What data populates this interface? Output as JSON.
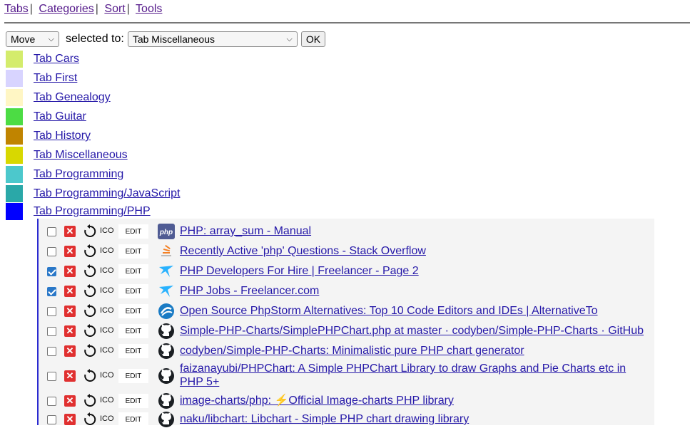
{
  "nav": {
    "tabs": "Tabs",
    "categories": "Categories",
    "sort": "Sort",
    "tools": "Tools"
  },
  "movebar": {
    "action": "Move",
    "selected_to": "selected to:",
    "target": "Tab Miscellaneous",
    "ok": "OK"
  },
  "tabs": [
    {
      "label": "Tab Cars",
      "color": "#d4ec6c"
    },
    {
      "label": "Tab First",
      "color": "#d8d4ff"
    },
    {
      "label": "Tab Genealogy",
      "color": "#fff6c4"
    },
    {
      "label": "Tab Guitar",
      "color": "#4cdc44"
    },
    {
      "label": "Tab History",
      "color": "#c08400"
    },
    {
      "label": "Tab Miscellaneous",
      "color": "#d8d800"
    },
    {
      "label": "Tab Programming",
      "color": "#4cc8cc"
    },
    {
      "label": "Tab Programming/JavaScript",
      "color": "#2aa8a8"
    },
    {
      "label": "Tab Programming/PHP",
      "color": "#0000ff"
    }
  ],
  "links": [
    {
      "checked": false,
      "icon": "php-icon",
      "ico": "ICO",
      "edit": "EDIT",
      "title": "PHP: array_sum - Manual"
    },
    {
      "checked": false,
      "icon": "stackoverflow-icon",
      "ico": "ICO",
      "edit": "EDIT",
      "title": "Recently Active 'php' Questions - Stack Overflow"
    },
    {
      "checked": true,
      "icon": "freelancer-icon",
      "ico": "ICO",
      "edit": "EDIT",
      "title": "PHP Developers For Hire | Freelancer - Page 2"
    },
    {
      "checked": true,
      "icon": "freelancer-icon",
      "ico": "ICO",
      "edit": "EDIT",
      "title": "PHP Jobs - Freelancer.com"
    },
    {
      "checked": false,
      "icon": "alternativeto-icon",
      "ico": "ICO",
      "edit": "EDIT",
      "title": "Open Source PhpStorm Alternatives: Top 10 Code Editors and IDEs | AlternativeTo"
    },
    {
      "checked": false,
      "icon": "github-icon",
      "ico": "ICO",
      "edit": "EDIT",
      "title": "Simple-PHP-Charts/SimplePHPChart.php at master · codyben/Simple-PHP-Charts · GitHub"
    },
    {
      "checked": false,
      "icon": "github-icon",
      "ico": "ICO",
      "edit": "EDIT",
      "title": "codyben/Simple-PHP-Charts: Minimalistic pure PHP chart generator"
    },
    {
      "checked": false,
      "icon": "github-icon",
      "ico": "ICO",
      "edit": "EDIT",
      "title": "faizanayubi/PHPChart: A Simple PHPChart Library to draw Graphs and Pie Charts etc in PHP 5+"
    },
    {
      "checked": false,
      "icon": "github-icon",
      "ico": "ICO",
      "edit": "EDIT",
      "title": "image-charts/php: ⚡Official Image-charts PHP library"
    },
    {
      "checked": false,
      "icon": "github-icon",
      "ico": "ICO",
      "edit": "EDIT",
      "title": "naku/libchart: Libchart - Simple PHP chart drawing library"
    }
  ]
}
